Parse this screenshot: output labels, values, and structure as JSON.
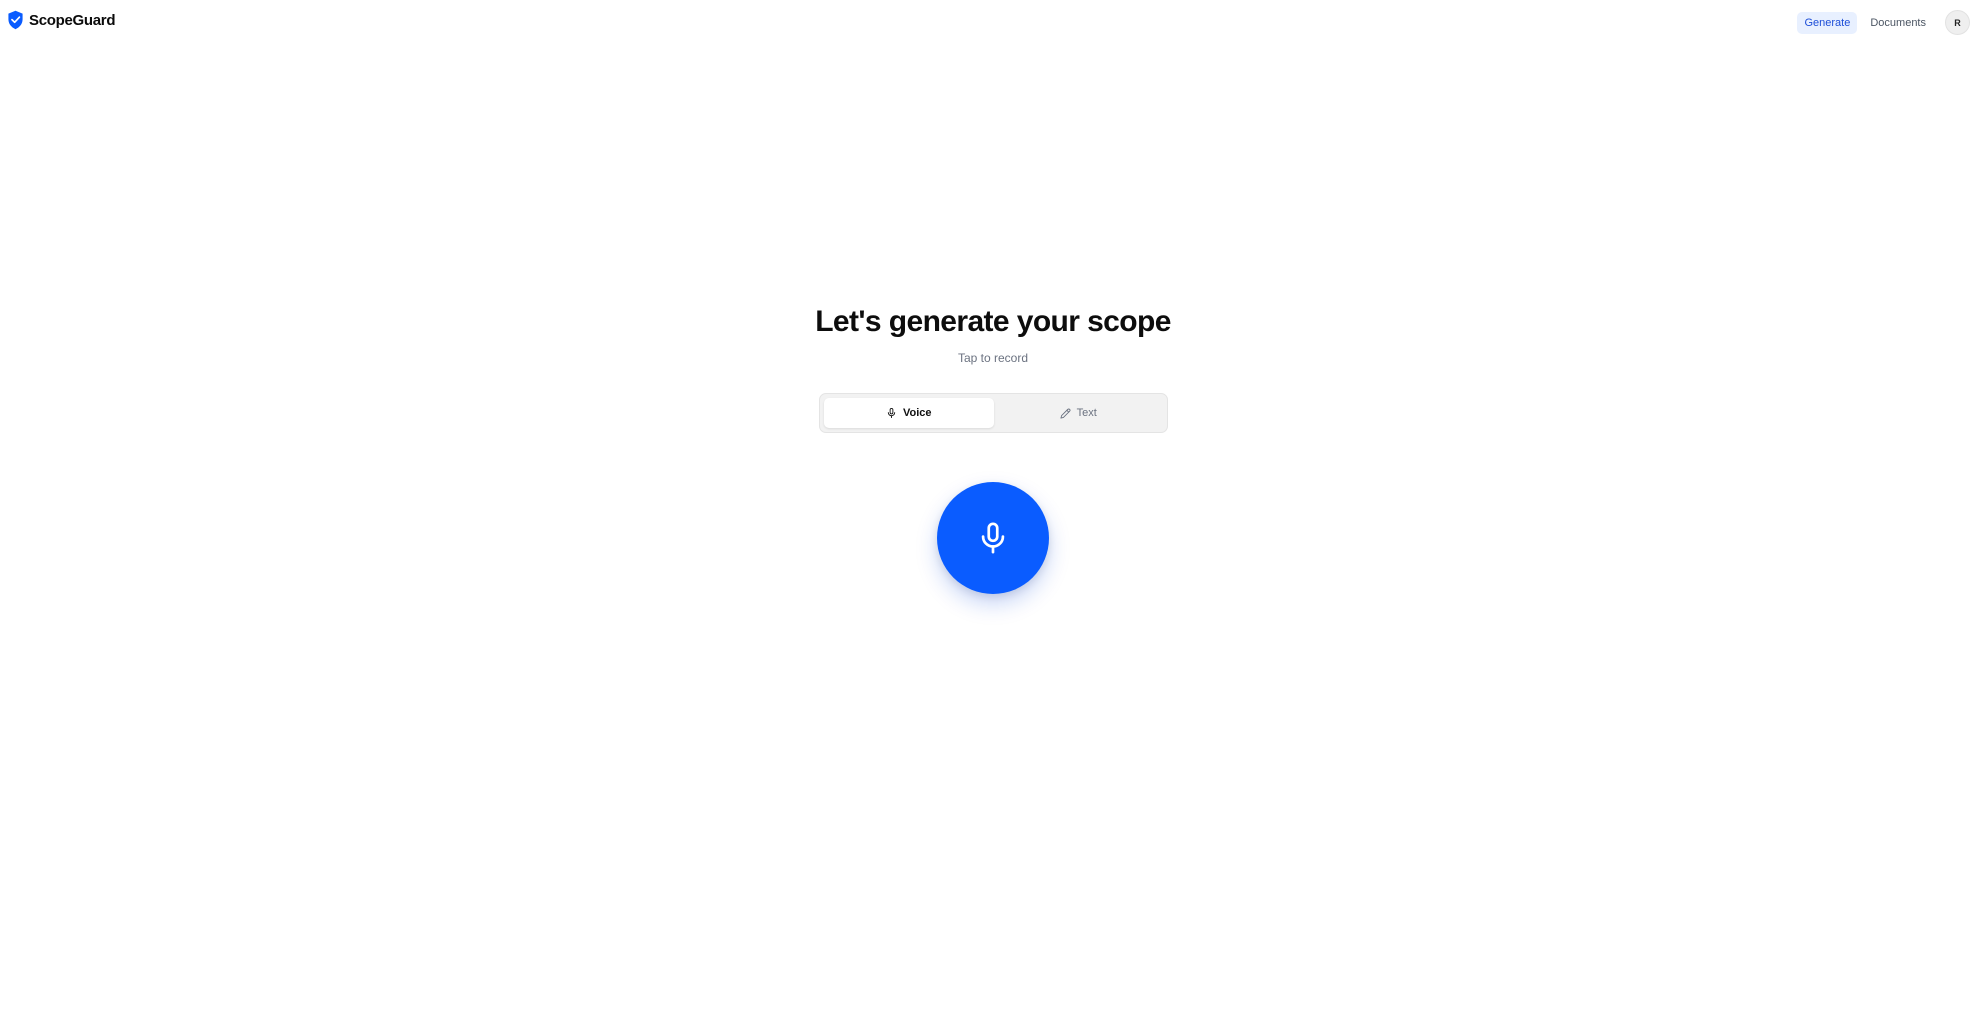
{
  "app": {
    "name": "ScopeGuard",
    "logo_icon": "shield-check-icon",
    "accent_color": "#0a5cff"
  },
  "nav": {
    "items": [
      {
        "label": "Generate",
        "active": true
      },
      {
        "label": "Documents",
        "active": false
      }
    ],
    "avatar_initial": "R"
  },
  "main": {
    "title": "Let's generate your scope",
    "subtitle": "Tap to record",
    "modes": [
      {
        "label": "Voice",
        "icon": "microphone-icon",
        "selected": true
      },
      {
        "label": "Text",
        "icon": "pencil-icon",
        "selected": false
      }
    ],
    "record_button": {
      "icon": "microphone-icon"
    }
  }
}
